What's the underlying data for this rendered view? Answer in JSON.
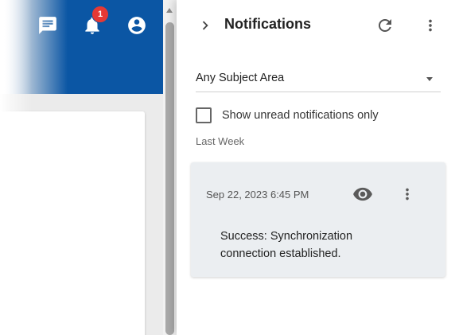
{
  "topbar": {
    "background_color": "#0b56a4",
    "icons": [
      "chat-icon",
      "bell-icon",
      "account-icon"
    ],
    "notification_count": "1"
  },
  "drawer": {
    "title": "Notifications",
    "subject_filter": {
      "selected": "Any Subject Area"
    },
    "unread_filter": {
      "label": "Show unread notifications only",
      "checked": false
    },
    "section_label": "Last Week",
    "notifications": [
      {
        "timestamp": "Sep 22, 2023 6:45 PM",
        "message": "Success: Synchronization connection established."
      }
    ]
  }
}
